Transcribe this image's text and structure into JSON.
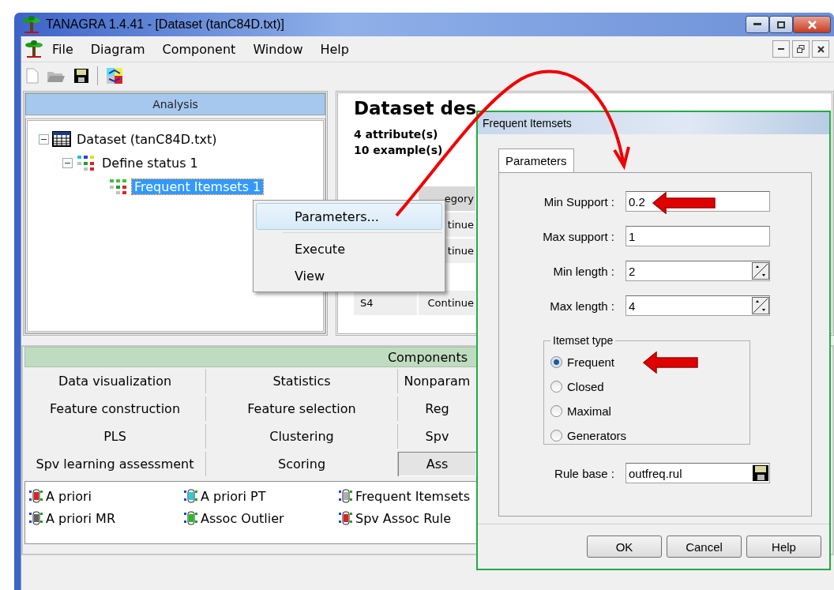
{
  "window": {
    "title": "TANAGRA 1.4.41 - [Dataset (tanC84D.txt)]"
  },
  "menu": [
    "File",
    "Diagram",
    "Component",
    "Window",
    "Help"
  ],
  "analysis": {
    "title": "Analysis",
    "tree": [
      {
        "label": "Dataset (tanC84D.txt)",
        "expanded": true,
        "selected": false,
        "children": [
          {
            "label": "Define status 1",
            "expanded": true,
            "selected": false,
            "children": [
              {
                "label": "Frequent Itemsets 1",
                "selected": true
              }
            ]
          }
        ]
      }
    ]
  },
  "context_menu": [
    {
      "label": "Parameters...",
      "selected": true
    },
    {
      "label": "Execute",
      "selected": false
    },
    {
      "label": "View",
      "selected": false
    }
  ],
  "dataset": {
    "title": "Dataset des",
    "lines": [
      "4 attribute(s)",
      "10 example(s)"
    ],
    "table": {
      "header": "egory",
      "rows": [
        [
          "tinue"
        ],
        [
          "tinue"
        ],
        [
          "S4",
          "Continue"
        ]
      ]
    }
  },
  "components": {
    "title": "Components",
    "tabs": [
      {
        "label": "Data visualization",
        "selected": false
      },
      {
        "label": "Statistics",
        "selected": false
      },
      {
        "label": "Nonparam",
        "selected": false
      },
      {
        "label": "Feature construction",
        "selected": false
      },
      {
        "label": "Feature selection",
        "selected": false
      },
      {
        "label": "Reg",
        "selected": false
      },
      {
        "label": "PLS",
        "selected": false
      },
      {
        "label": "Clustering",
        "selected": false
      },
      {
        "label": "Spv",
        "selected": false
      },
      {
        "label": "Spv learning assessment",
        "selected": false
      },
      {
        "label": "Scoring",
        "selected": false
      },
      {
        "label": "Ass",
        "selected": true
      }
    ],
    "items": [
      {
        "label": "A priori",
        "color": "#e02020"
      },
      {
        "label": "A priori PT",
        "color": "#20d0e0"
      },
      {
        "label": "Frequent Itemsets",
        "color": "#b0b0b0"
      },
      {
        "label": "A priori MR",
        "color": "#606060"
      },
      {
        "label": "Assoc Outlier",
        "color": "#20c020"
      },
      {
        "label": "Spv Assoc Rule",
        "color": "#e02020"
      }
    ]
  },
  "dialog": {
    "title": "Frequent Itemsets",
    "tab": {
      "label": "Parameters",
      "selected": true
    },
    "fields": [
      {
        "label": "Min Support :",
        "value": "0.2",
        "kind": "text"
      },
      {
        "label": "Max support :",
        "value": "1",
        "kind": "text"
      },
      {
        "label": "Min length :",
        "value": "2",
        "kind": "spin"
      },
      {
        "label": "Max length :",
        "value": "4",
        "kind": "spin"
      }
    ],
    "group": {
      "title": "Itemset type",
      "options": [
        {
          "label": "Frequent",
          "selected": true
        },
        {
          "label": "Closed",
          "selected": false
        },
        {
          "label": "Maximal",
          "selected": false
        },
        {
          "label": "Generators",
          "selected": false
        }
      ]
    },
    "rule_base": {
      "label": "Rule base :",
      "value": "outfreq.rul"
    },
    "buttons": [
      "OK",
      "Cancel",
      "Help"
    ]
  }
}
